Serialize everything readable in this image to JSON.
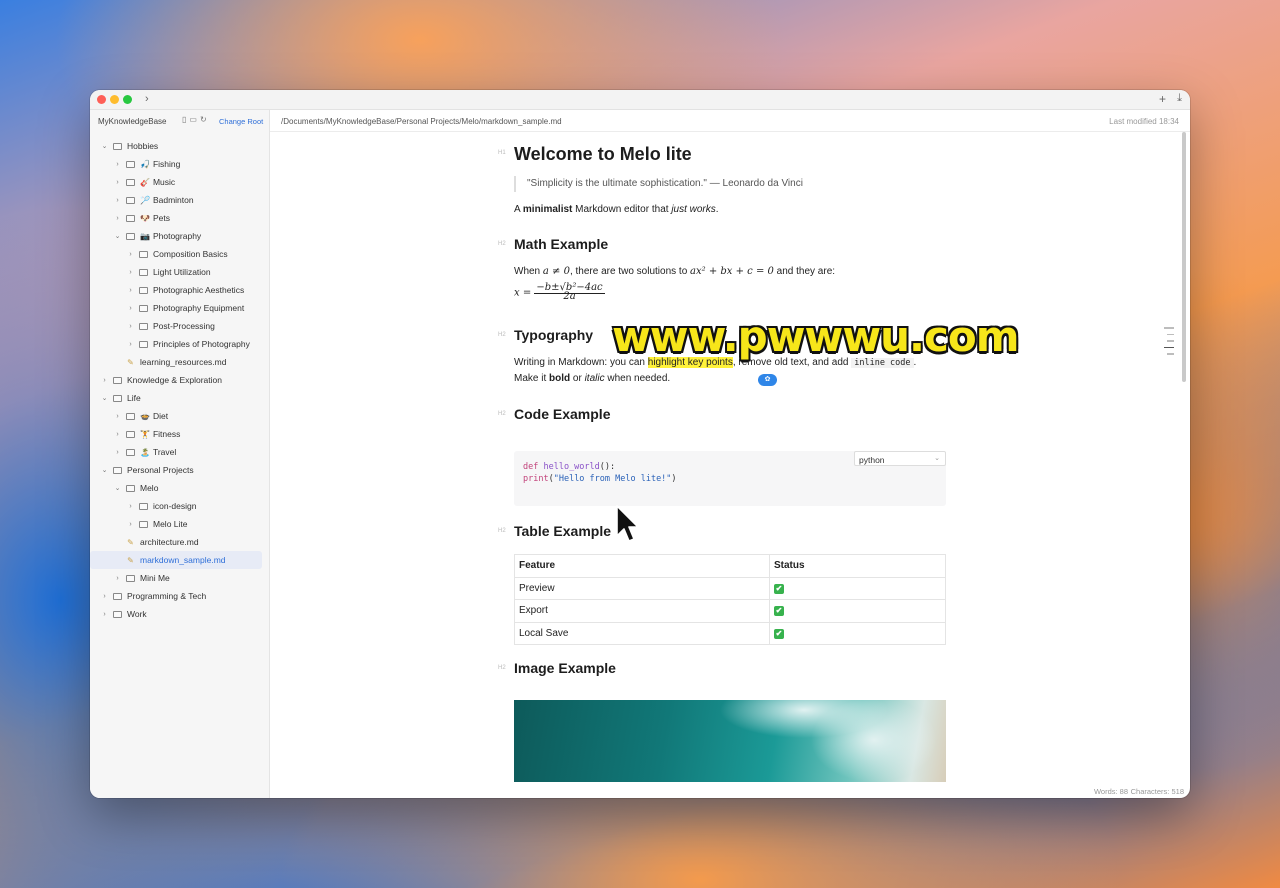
{
  "window": {
    "chevron": "›",
    "new_icon": "+",
    "download_icon": "⤓"
  },
  "sidebar": {
    "root_name": "MyKnowledgeBase",
    "change_root": "Change Root",
    "items": [
      {
        "label": "Hobbies",
        "emoji": ""
      },
      {
        "label": "Fishing",
        "emoji": "🎣"
      },
      {
        "label": "Music",
        "emoji": "🎸"
      },
      {
        "label": "Badminton",
        "emoji": "🏸"
      },
      {
        "label": "Pets",
        "emoji": "🐶"
      },
      {
        "label": "Photography",
        "emoji": "📷"
      },
      {
        "label": "Composition Basics",
        "emoji": ""
      },
      {
        "label": "Light Utilization",
        "emoji": ""
      },
      {
        "label": "Photographic Aesthetics",
        "emoji": ""
      },
      {
        "label": "Photography Equipment",
        "emoji": ""
      },
      {
        "label": "Post-Processing",
        "emoji": ""
      },
      {
        "label": "Principles of Photography",
        "emoji": ""
      },
      {
        "label": "learning_resources.md",
        "emoji": ""
      },
      {
        "label": "Knowledge & Exploration",
        "emoji": ""
      },
      {
        "label": "Life",
        "emoji": ""
      },
      {
        "label": "Diet",
        "emoji": "🍲"
      },
      {
        "label": "Fitness",
        "emoji": "🏋️"
      },
      {
        "label": "Travel",
        "emoji": "🏝️"
      },
      {
        "label": "Personal Projects",
        "emoji": ""
      },
      {
        "label": "Melo",
        "emoji": ""
      },
      {
        "label": "icon-design",
        "emoji": ""
      },
      {
        "label": "Melo Lite",
        "emoji": ""
      },
      {
        "label": "architecture.md",
        "emoji": ""
      },
      {
        "label": "markdown_sample.md",
        "emoji": ""
      },
      {
        "label": "Mini Me",
        "emoji": ""
      },
      {
        "label": "Programming & Tech",
        "emoji": ""
      },
      {
        "label": "Work",
        "emoji": ""
      }
    ]
  },
  "pathbar": {
    "path": "/Documents/MyKnowledgeBase/Personal Projects/Melo/markdown_sample.md",
    "modified": "Last modified 18:34"
  },
  "doc": {
    "h_marker": "H1",
    "h2_marker": "H2",
    "title": "Welcome to Melo lite",
    "quote": "\"Simplicity is the ultimate sophistication.\" — Leonardo da Vinci",
    "intro_a": "A ",
    "intro_bold": "minimalist",
    "intro_b": " Markdown editor that ",
    "intro_italic": "just works",
    "intro_c": ".",
    "math_heading": "Math Example",
    "math_text_a": "When ",
    "math_expr_1": "a ≠ 0",
    "math_text_b": ", there are two solutions to ",
    "math_expr_2": "ax² + bx + c = 0",
    "math_text_c": " and they are:",
    "math_lhs": "x = ",
    "math_num": "−b±√b²−4ac",
    "math_den": "2a",
    "typo_heading": "Typography",
    "typo_a": "Writing in Markdown: you can ",
    "typo_highlight": "highlight key points",
    "typo_b": ", remove old text, and add ",
    "typo_code": "inline code",
    "typo_c": ".",
    "typo2_a": "Make it ",
    "typo2_bold": "bold",
    "typo2_b": " or ",
    "typo2_italic": "italic",
    "typo2_c": " when needed.",
    "code_heading": "Code Example",
    "code_lang": "python",
    "code_line1_kw": "def",
    "code_line1_fn": " hello_world",
    "code_line1_rest": "():",
    "code_line2_fn": "print",
    "code_line2_open": "(",
    "code_line2_str": "\"Hello from Melo lite!\"",
    "code_line2_close": ")",
    "table_heading": "Table Example",
    "table_headers": [
      "Feature",
      "Status"
    ],
    "table_rows": [
      {
        "feature": "Preview",
        "status": "✔"
      },
      {
        "feature": "Export",
        "status": "✔"
      },
      {
        "feature": "Local Save",
        "status": "✔"
      }
    ],
    "image_heading": "Image Example"
  },
  "statusbar": {
    "words": "Words: 88",
    "characters": "Characters: 518"
  },
  "watermark": "www.pwwwu.com",
  "colors": {
    "accent": "#2f6fd8",
    "highlight": "#fff23a",
    "check": "#37b24d"
  }
}
